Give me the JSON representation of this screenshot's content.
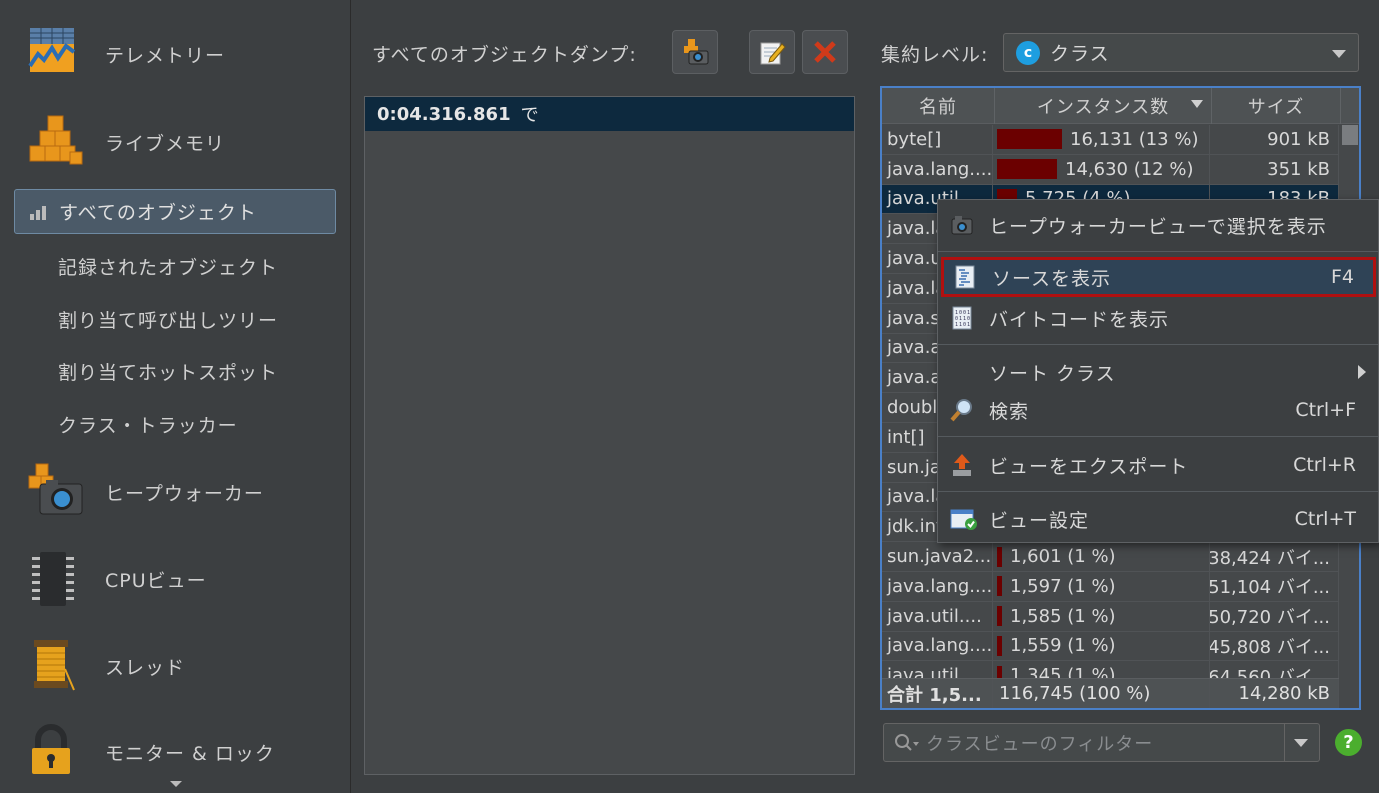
{
  "sidebar": {
    "telemetry": "テレメトリー",
    "live_memory": "ライブメモリ",
    "all_objects": "すべてのオブジェクト",
    "recorded_objects": "記録されたオブジェクト",
    "alloc_call_tree": "割り当て呼び出しツリー",
    "alloc_hot_spots": "割り当てホットスポット",
    "class_tracker": "クラス・トラッカー",
    "heap_walker": "ヒープウォーカー",
    "cpu_views": "CPUビュー",
    "threads": "スレッド",
    "monitors_locks": "モニター & ロック"
  },
  "dump": {
    "label": "すべてのオブジェクトダンプ:",
    "time": "0:04.316.861",
    "time_suffix": "で"
  },
  "aggregation": {
    "label": "集約レベル:",
    "value": "クラス",
    "icon_letter": "c"
  },
  "table": {
    "columns": {
      "name": "名前",
      "instances": "インスタンス数",
      "size": "サイズ"
    },
    "rows": [
      {
        "name": "byte[]",
        "instances": "16,131 (13 %)",
        "pct": 13,
        "size": "901 kB"
      },
      {
        "name": "java.lang....",
        "instances": "14,630 (12 %)",
        "pct": 12,
        "size": "351 kB"
      },
      {
        "name": "java.util....",
        "instances": "5,725 (4 %)",
        "pct": 4,
        "size": "183 kB"
      },
      {
        "name": "java.la",
        "instances": "",
        "pct": 0,
        "size": ""
      },
      {
        "name": "java.ut",
        "instances": "",
        "pct": 0,
        "size": ""
      },
      {
        "name": "java.la",
        "instances": "",
        "pct": 0,
        "size": ""
      },
      {
        "name": "java.se",
        "instances": "",
        "pct": 0,
        "size": ""
      },
      {
        "name": "java.aw",
        "instances": "",
        "pct": 0,
        "size": ""
      },
      {
        "name": "java.aw",
        "instances": "",
        "pct": 0,
        "size": ""
      },
      {
        "name": "doubl",
        "instances": "",
        "pct": 0,
        "size": ""
      },
      {
        "name": "int[]",
        "instances": "",
        "pct": 0,
        "size": ""
      },
      {
        "name": "sun.jav",
        "instances": "",
        "pct": 0,
        "size": ""
      },
      {
        "name": "java.la",
        "instances": "",
        "pct": 0,
        "size": ""
      },
      {
        "name": "jdk.int",
        "instances": "",
        "pct": 0,
        "size": ""
      },
      {
        "name": "sun.java2...",
        "instances": "1,601 (1 %)",
        "pct": 1,
        "size": "38,424 バイ..."
      },
      {
        "name": "java.lang....",
        "instances": "1,597 (1 %)",
        "pct": 1,
        "size": "51,104 バイ..."
      },
      {
        "name": "java.util....",
        "instances": "1,585 (1 %)",
        "pct": 1,
        "size": "50,720 バイ..."
      },
      {
        "name": "java.lang....",
        "instances": "1,559 (1 %)",
        "pct": 1,
        "size": "45,808 バイ..."
      },
      {
        "name": "java.util....",
        "instances": "1,345 (1 %)",
        "pct": 1,
        "size": "64,560 バイ..."
      }
    ],
    "total": {
      "name": "合計 1,5...",
      "instances": "116,745 (100 %)",
      "size": "14,280 kB"
    }
  },
  "filter": {
    "placeholder": "クラスビューのフィルター"
  },
  "help": "?",
  "context_menu": {
    "show_in_heap_walker": "ヒープウォーカービューで選択を表示",
    "show_source": "ソースを表示",
    "show_source_key": "F4",
    "show_bytecode": "バイトコードを表示",
    "sort_classes": "ソート クラス",
    "find": "検索",
    "find_key": "Ctrl+F",
    "export_view": "ビューをエクスポート",
    "export_view_key": "Ctrl+R",
    "view_settings": "ビュー設定",
    "view_settings_key": "Ctrl+T"
  },
  "colors": {
    "selection": "#0d293e",
    "bar": "#6b0000",
    "highlight_border": "#b01010",
    "table_border": "#4a80c8"
  }
}
